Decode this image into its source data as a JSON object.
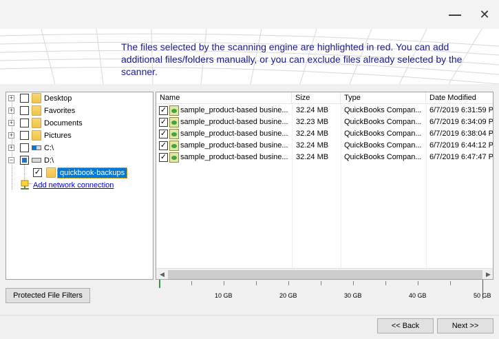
{
  "window": {
    "minimize_glyph": "—",
    "close_glyph": "✕"
  },
  "instruction": "The files selected by the scanning engine are highlighted in red.  You can add additional files/folders manually, or you can exclude files already selected by the scanner.",
  "tree": {
    "items": [
      {
        "label": "Desktop",
        "icon": "folder-icon"
      },
      {
        "label": "Favorites",
        "icon": "folder-icon"
      },
      {
        "label": "Documents",
        "icon": "folder-icon"
      },
      {
        "label": "Pictures",
        "icon": "folder-icon"
      },
      {
        "label": "C:\\",
        "icon": "system-drive-icon"
      },
      {
        "label": "D:\\",
        "icon": "drive-icon"
      }
    ],
    "selected_child": "quickbook-backups",
    "add_network": "Add network connection"
  },
  "filelist": {
    "columns": {
      "name": "Name",
      "size": "Size",
      "type": "Type",
      "date": "Date Modified"
    },
    "rows": [
      {
        "name": "sample_product-based busine...",
        "size": "32.24 MB",
        "type": "QuickBooks Compan...",
        "date": "6/7/2019 6:31:59 P"
      },
      {
        "name": "sample_product-based busine...",
        "size": "32.23 MB",
        "type": "QuickBooks Compan...",
        "date": "6/7/2019 6:34:09 P"
      },
      {
        "name": "sample_product-based busine...",
        "size": "32.24 MB",
        "type": "QuickBooks Compan...",
        "date": "6/7/2019 6:38:04 P"
      },
      {
        "name": "sample_product-based busine...",
        "size": "32.24 MB",
        "type": "QuickBooks Compan...",
        "date": "6/7/2019 6:44:12 P"
      },
      {
        "name": "sample_product-based busine...",
        "size": "32.24 MB",
        "type": "QuickBooks Compan...",
        "date": "6/7/2019 6:47:47 P"
      }
    ],
    "checked_glyph": "✓"
  },
  "size_ruler": {
    "labels": [
      "10 GB",
      "20 GB",
      "30 GB",
      "40 GB",
      "50 GB"
    ],
    "usage_color": "#2e9e3a",
    "limit_color": "#d21f1f"
  },
  "buttons": {
    "filters": "Protected File Filters",
    "back": "<< Back",
    "next": "Next >>"
  },
  "colors": {
    "instruction_text": "#1a1a8c",
    "selection": "#0078d7",
    "link": "#0000cc"
  }
}
